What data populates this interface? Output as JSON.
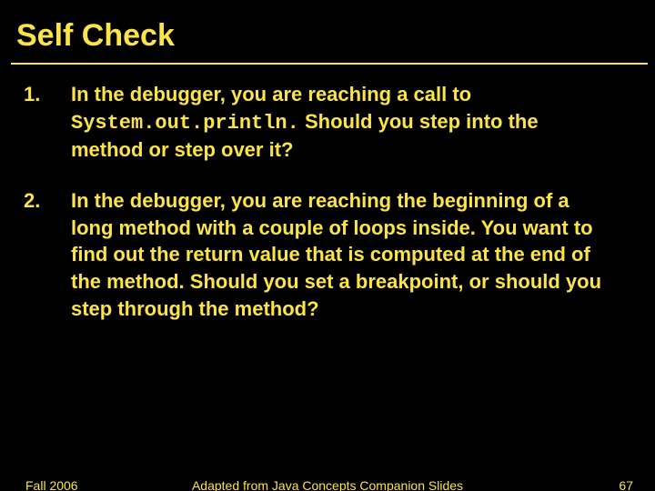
{
  "title": "Self Check",
  "items": [
    {
      "num": "1.",
      "prefix": "In the debugger, you are reaching a call to ",
      "code": "System.out.println.",
      "suffix": " Should you step into the method or step over it?"
    },
    {
      "num": "2.",
      "prefix": "In the debugger, you are reaching the beginning of a long method with a couple of loops inside. You want to find out the return value that is computed at the end of the method. Should you set a breakpoint, or should you step through the method?",
      "code": "",
      "suffix": ""
    }
  ],
  "footer": {
    "left": "Fall 2006",
    "center": "Adapted from Java Concepts Companion Slides",
    "right": "67"
  }
}
